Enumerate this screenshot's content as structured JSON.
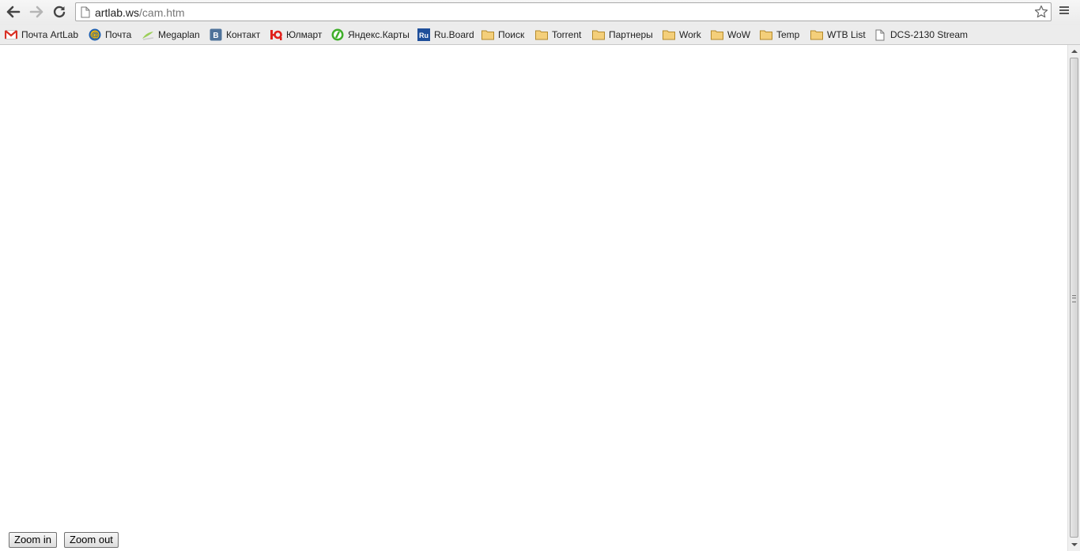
{
  "browser": {
    "url_host": "artlab.ws",
    "url_path": "/cam.htm"
  },
  "bookmarks": [
    {
      "label": "Почта ArtLab",
      "icon": "gmail-icon"
    },
    {
      "label": "Почта",
      "icon": "mail-at-icon"
    },
    {
      "label": "Megaplan",
      "icon": "megaplan-icon"
    },
    {
      "label": "Контакт",
      "icon": "vk-icon"
    },
    {
      "label": "Юлмарт",
      "icon": "ulmart-icon"
    },
    {
      "label": "Яндекс.Карты",
      "icon": "yandex-maps-icon"
    },
    {
      "label": "Ru.Board",
      "icon": "ruboard-icon"
    },
    {
      "label": "Поиск",
      "icon": "folder-icon"
    },
    {
      "label": "Torrent",
      "icon": "folder-icon"
    },
    {
      "label": "Партнеры",
      "icon": "folder-icon"
    },
    {
      "label": "Work",
      "icon": "folder-icon"
    },
    {
      "label": "WoW",
      "icon": "folder-icon"
    },
    {
      "label": "Temp",
      "icon": "folder-icon"
    },
    {
      "label": "WTB List",
      "icon": "folder-icon"
    },
    {
      "label": "DCS-2130 Stream",
      "icon": "page-icon"
    }
  ],
  "page": {
    "zoom_in_label": "Zoom in",
    "zoom_out_label": "Zoom out"
  },
  "colors": {
    "folder": "#f4cf7a",
    "vk": "#4e729a",
    "ruboard": "#1f4f9a",
    "gmail_red": "#d93025"
  }
}
